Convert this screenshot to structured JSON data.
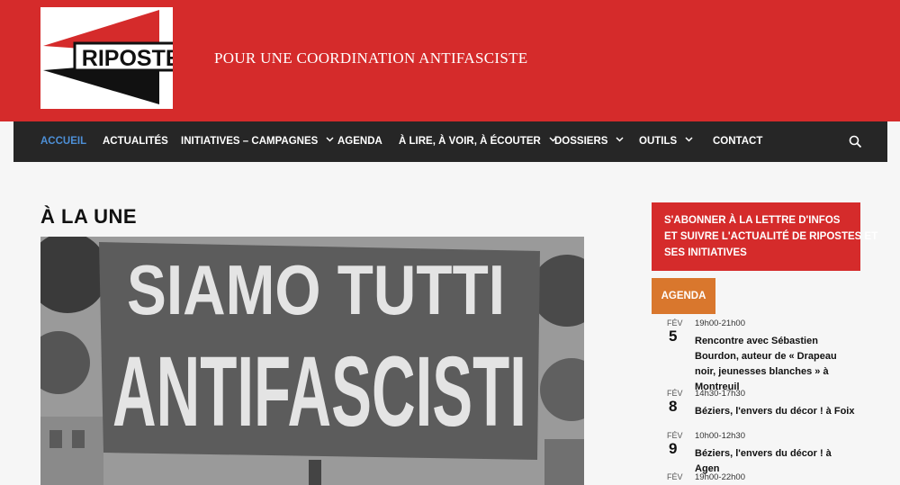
{
  "header": {
    "logo_text": "RIPOSTES",
    "tagline": "POUR UNE COORDINATION ANTIFASCISTE"
  },
  "nav": {
    "items": [
      {
        "label": "ACCUEIL",
        "active": true
      },
      {
        "label": "ACTUALITÉS"
      },
      {
        "label": "INITIATIVES – CAMPAGNES",
        "dropdown": true
      },
      {
        "label": "AGENDA"
      },
      {
        "label": "À LIRE, À VOIR, À ÉCOUTER",
        "dropdown": true
      },
      {
        "label": "DOSSIERS",
        "dropdown": true
      },
      {
        "label": "OUTILS",
        "dropdown": true
      },
      {
        "label": "CONTACT"
      }
    ],
    "search_icon": "search-icon"
  },
  "main": {
    "section_title": "À LA UNE",
    "hero_sign": {
      "line1": "SIAMO TUTTI",
      "line2": "ANTIFASCISTI"
    }
  },
  "sidebar": {
    "subscribe_lines": [
      "S'ABONNER À LA LETTRE D'INFOS",
      "ET SUIVRE L'ACTUALITÉ DE RIPOSTES ET",
      "SES INITIATIVES"
    ],
    "agenda_label": "AGENDA",
    "events": [
      {
        "month": "FÉV",
        "day": "5",
        "time": "19h00-21h00",
        "title": "Rencontre avec Sébastien Bourdon, auteur de « Drapeau noir, jeunesses blanches » à Montreuil"
      },
      {
        "month": "FÉV",
        "day": "8",
        "time": "14h30-17h30",
        "title": "Béziers, l'envers du décor ! à Foix"
      },
      {
        "month": "FÉV",
        "day": "9",
        "time": "10h00-12h30",
        "title": "Béziers, l'envers du décor ! à Agen"
      },
      {
        "month": "FÉV",
        "day": "",
        "time": "19h00-22h00",
        "title": ""
      }
    ]
  },
  "colors": {
    "brand_red": "#d52b2b",
    "nav_bg": "#262626",
    "nav_active": "#4d8fd6",
    "agenda_orange": "#d9772d",
    "page_bg": "#f6f6f6"
  }
}
